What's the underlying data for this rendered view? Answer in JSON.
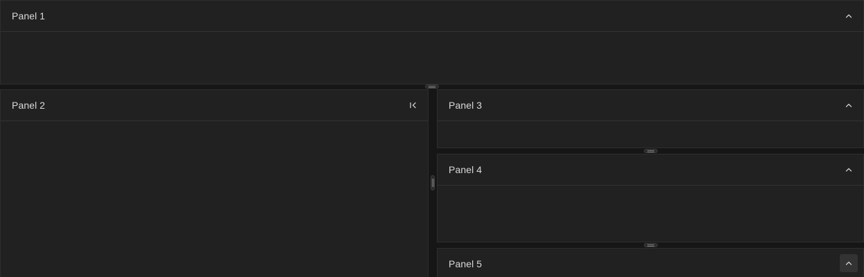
{
  "colors": {
    "background": "#161616",
    "panel": "#212121",
    "border": "#2e2e2e",
    "text": "#d9d9d9"
  },
  "panels": [
    {
      "title": "Panel 1",
      "button_icon": "chevron-up-icon"
    },
    {
      "title": "Panel 2",
      "button_icon": "collapse-left-icon"
    },
    {
      "title": "Panel 3",
      "button_icon": "chevron-up-icon"
    },
    {
      "title": "Panel 4",
      "button_icon": "chevron-up-icon"
    },
    {
      "title": "Panel 5",
      "button_icon": "chevron-up-icon"
    }
  ]
}
